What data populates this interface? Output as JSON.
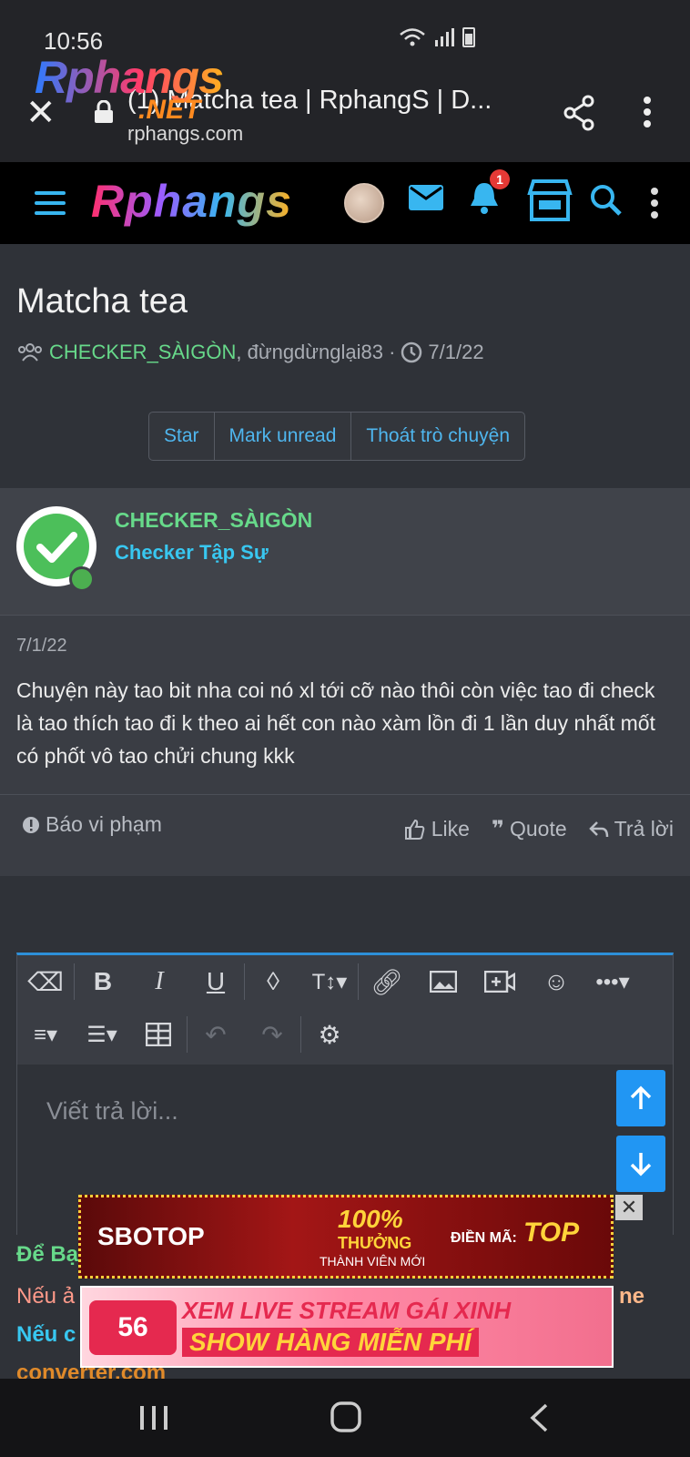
{
  "status_bar": {
    "time": "10:56"
  },
  "browser": {
    "page_title": "(1) Matcha tea | RphangS | D...",
    "host": "rphangs.com",
    "overlay_logo": "Rphangs",
    "overlay_logo_suffix": ".NET"
  },
  "site": {
    "logo": "Rphangs",
    "notification_count": "1"
  },
  "thread": {
    "title": "Matcha tea",
    "author": "CHECKER_SÀIGÒN",
    "participants": ", đừngdừnglại83 · ",
    "date": "7/1/22",
    "buttons": [
      "Star",
      "Mark unread",
      "Thoát trò chuyện"
    ]
  },
  "post": {
    "username": "CHECKER_SÀIGÒN",
    "rank": "Checker Tập Sự",
    "date": "7/1/22",
    "body": "Chuyện này tao bit nha coi nó xl tới cỡ nào thôi còn việc tao đi check là tao thích tao đi k theo ai hết con nào xàm lồn đi 1 lần duy nhất mốt có phốt vô tao chửi chung kkk",
    "report_label": "Báo vi phạm",
    "like_label": "Like",
    "quote_label": "Quote",
    "reply_label": "Trả lời"
  },
  "editor": {
    "placeholder": "Viết trả lời..."
  },
  "background_text": {
    "line1": "Để Bạ",
    "line2": "Nếu ả",
    "line2_right": "ne",
    "line3": "Nếu c",
    "line4": "converter.com"
  },
  "ads": {
    "ad1_brand": "SBOTOP",
    "ad1_promo": "100%",
    "ad1_sub1": "THƯỞNG",
    "ad1_sub2": "THÀNH VIÊN MỚI",
    "ad1_code_label": "ĐIỀN MÃ:",
    "ad1_code": "TOP",
    "ad2_logo": "56",
    "ad2_line1": "XEM LIVE STREAM GÁI XINH",
    "ad2_line2": "SHOW HÀNG MIỄN PHÍ"
  },
  "colors": {
    "accent_blue": "#4fb6ee",
    "username_green": "#67d98a",
    "rank_cyan": "#38c7f0",
    "editor_accent": "#2196f3"
  }
}
